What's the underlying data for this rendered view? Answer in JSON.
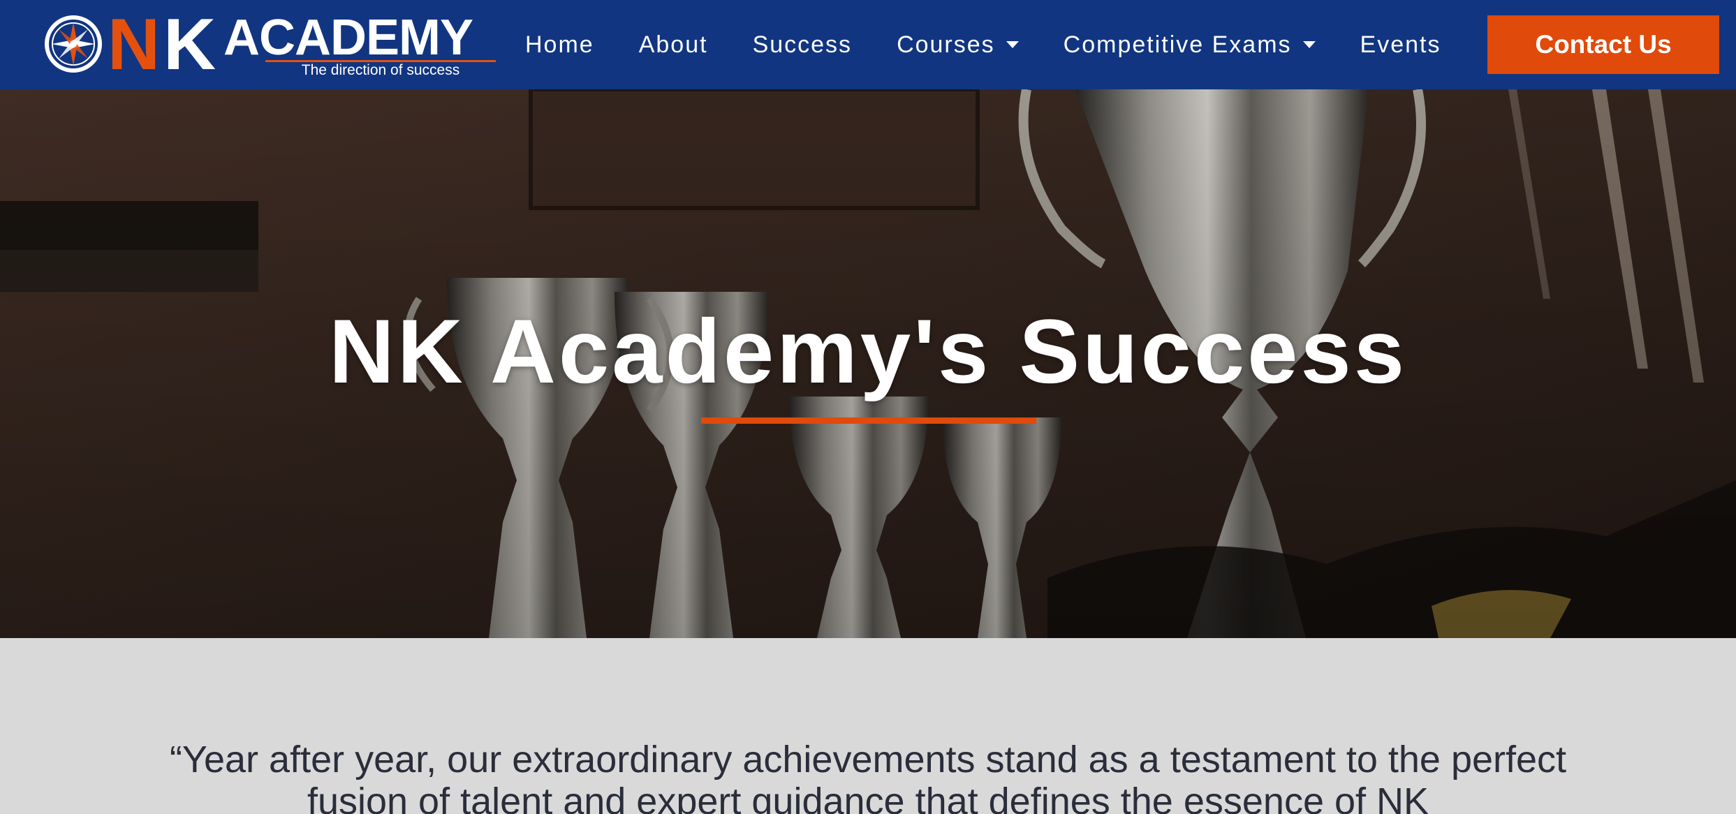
{
  "brand": {
    "letter_n": "N",
    "letter_k": "K",
    "wordmark": "ACADEMY",
    "tagline": "The direction of success",
    "icon": "compass-icon"
  },
  "nav": {
    "items": [
      {
        "label": "Home",
        "has_dropdown": false
      },
      {
        "label": "About",
        "has_dropdown": false
      },
      {
        "label": "Success",
        "has_dropdown": false
      },
      {
        "label": "Courses",
        "has_dropdown": true
      },
      {
        "label": "Competitive Exams",
        "has_dropdown": true
      },
      {
        "label": "Events",
        "has_dropdown": false
      }
    ],
    "cta": "Contact Us"
  },
  "hero": {
    "title": "NK Academy's Success",
    "background": "trophy-photo"
  },
  "quote": {
    "text": "“Year after year, our extraordinary achievements stand as a testament to the perfect fusion of talent and expert guidance that defines the essence of NK"
  },
  "colors": {
    "navbar": "#113581",
    "accent": "#e04a0a",
    "section_bg": "#d9d9d9",
    "quote_text": "#2a2d3a"
  }
}
